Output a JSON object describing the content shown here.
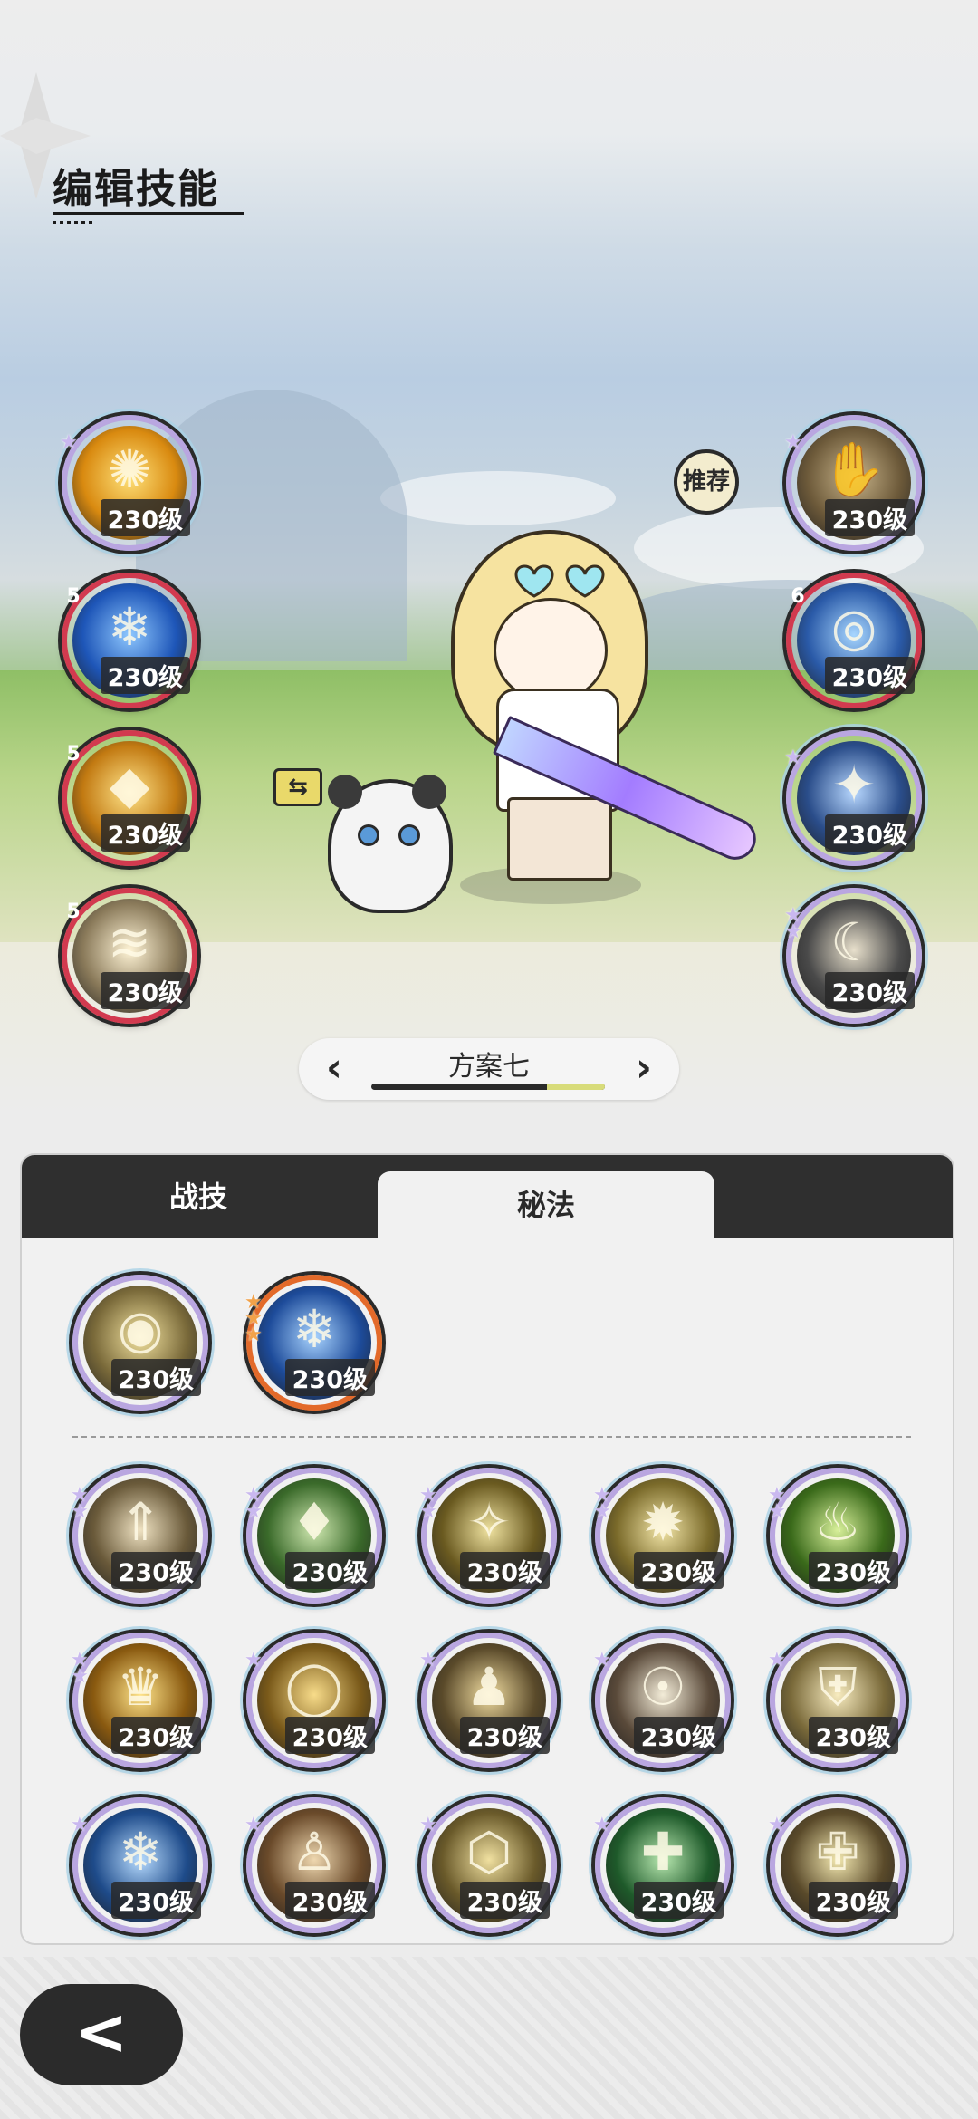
{
  "page": {
    "title": "编辑技能"
  },
  "scene": {
    "recommend_label": "推荐",
    "swap_label": "⇆"
  },
  "left_skills": [
    {
      "name": "explosion-skill",
      "level": "230级",
      "badge": "",
      "stars": "★",
      "frame": "rainbow",
      "c1": "#ffe27a",
      "c2": "#d98a10",
      "glyph": "✺"
    },
    {
      "name": "ice-burst-skill",
      "level": "230级",
      "badge": "5",
      "stars": "",
      "frame": "red",
      "c1": "#8fc8ff",
      "c2": "#1e56b8",
      "glyph": "❄"
    },
    {
      "name": "golden-shield-skill",
      "level": "230级",
      "badge": "5",
      "stars": "",
      "frame": "red",
      "c1": "#ffe48a",
      "c2": "#c27a12",
      "glyph": "◆"
    },
    {
      "name": "slash-skill",
      "level": "230级",
      "badge": "5",
      "stars": "",
      "frame": "red",
      "c1": "#fff4d6",
      "c2": "#8a7a5a",
      "glyph": "≋"
    }
  ],
  "right_skills": [
    {
      "name": "bronze-hand-skill",
      "level": "230级",
      "badge": "",
      "stars": "★",
      "frame": "rainbow",
      "c1": "#c8b48a",
      "c2": "#6d5a3a",
      "glyph": "✋"
    },
    {
      "name": "water-spin-skill",
      "level": "230级",
      "badge": "6",
      "stars": "",
      "frame": "red",
      "c1": "#a7d6ff",
      "c2": "#2a5aa8",
      "glyph": "◎"
    },
    {
      "name": "ice-crystal-skill",
      "level": "230级",
      "badge": "",
      "stars": "★",
      "frame": "rainbow",
      "c1": "#b8d8ff",
      "c2": "#2a4d8a",
      "glyph": "✦"
    },
    {
      "name": "moon-skill",
      "level": "230级",
      "badge": "",
      "stars": "★★",
      "frame": "rainbow",
      "c1": "#e8e0cc",
      "c2": "#4a4a4a",
      "glyph": "☾"
    }
  ],
  "plan": {
    "name": "方案七",
    "progress": 0.25
  },
  "tabs": {
    "tab1": "战技",
    "tab2": "秘法"
  },
  "equipped": [
    {
      "name": "all-seeing-eye-skill",
      "level": "230级",
      "stars": "",
      "frame": "rainbow",
      "c1": "#f3e3a0",
      "c2": "#7a6a3a",
      "glyph": "◉"
    },
    {
      "name": "frost-orb-skill",
      "level": "230级",
      "stars": "★★★",
      "frame": "orange",
      "c1": "#a9d4ff",
      "c2": "#1d4b9a",
      "glyph": "❄"
    }
  ],
  "grid": [
    {
      "name": "arrow-up-skill",
      "level": "230级",
      "stars": "★★",
      "c1": "#efe2c2",
      "c2": "#6a5a3a",
      "glyph": "⇑"
    },
    {
      "name": "green-crest-skill",
      "level": "230级",
      "stars": "★★",
      "c1": "#cfe8b0",
      "c2": "#3a6a2a",
      "glyph": "♦"
    },
    {
      "name": "compass-skill",
      "level": "230级",
      "stars": "★★",
      "c1": "#efe2a0",
      "c2": "#6a5a20",
      "glyph": "✧"
    },
    {
      "name": "starburst-skill",
      "level": "230级",
      "stars": "★★",
      "c1": "#f3e6a8",
      "c2": "#7a6a2a",
      "glyph": "✹"
    },
    {
      "name": "green-flame-skill",
      "level": "230级",
      "stars": "★★",
      "c1": "#d8f09a",
      "c2": "#3a6a1a",
      "glyph": "♨"
    },
    {
      "name": "golden-crown-skill",
      "level": "230级",
      "stars": "★★",
      "c1": "#ffe48a",
      "c2": "#8a5a10",
      "glyph": "♛"
    },
    {
      "name": "golden-ring-skill",
      "level": "230级",
      "stars": "★",
      "c1": "#f8dc8a",
      "c2": "#7a5a1a",
      "glyph": "◯"
    },
    {
      "name": "summon-figures-skill",
      "level": "230级",
      "stars": "★",
      "c1": "#f0dca0",
      "c2": "#5a4a2a",
      "glyph": "♟"
    },
    {
      "name": "hood-skill",
      "level": "230级",
      "stars": "★",
      "c1": "#f3ecd8",
      "c2": "#5a4a3a",
      "glyph": "☉"
    },
    {
      "name": "white-shield-skill",
      "level": "230级",
      "stars": "★",
      "c1": "#f8ecc0",
      "c2": "#7a6a3a",
      "glyph": "⛨"
    },
    {
      "name": "snowflake-skill",
      "level": "230级",
      "stars": "★",
      "c1": "#b8dcff",
      "c2": "#1e4b8a",
      "glyph": "❄"
    },
    {
      "name": "rising-figure-skill",
      "level": "230级",
      "stars": "★",
      "c1": "#efd8b0",
      "c2": "#6a4a2a",
      "glyph": "♙"
    },
    {
      "name": "hexagon-skill",
      "level": "230级",
      "stars": "★",
      "c1": "#f0e0a0",
      "c2": "#6a5a2a",
      "glyph": "⬡"
    },
    {
      "name": "green-cross-skill",
      "level": "230级",
      "stars": "★",
      "c1": "#b8e8b0",
      "c2": "#1e5a2a",
      "glyph": "✚"
    },
    {
      "name": "healer-figure-skill",
      "level": "230级",
      "stars": "★",
      "c1": "#f3e8b0",
      "c2": "#5a4a2a",
      "glyph": "✙"
    }
  ],
  "back_label": "<"
}
